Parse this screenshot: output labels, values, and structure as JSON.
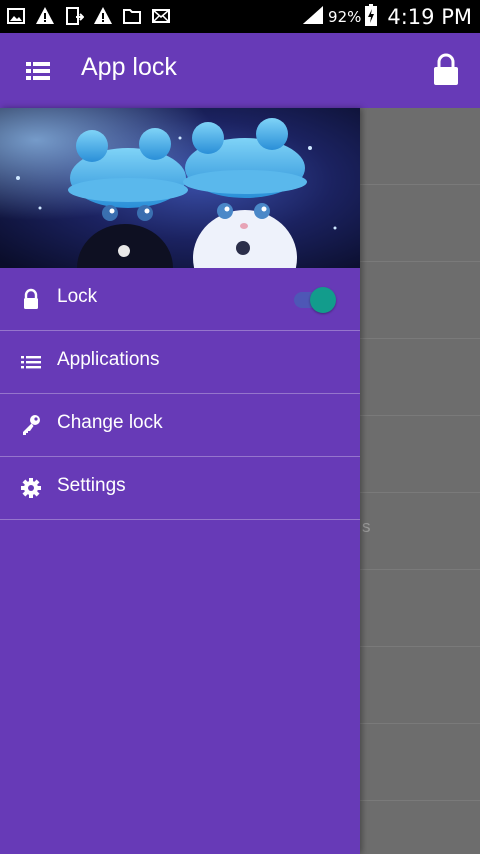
{
  "status_bar": {
    "notification_icons": [
      "image-icon",
      "warning-icon",
      "download-icon",
      "warning-icon",
      "folder-icon",
      "mail-icon"
    ],
    "battery_percent": "92%",
    "time": "4:19 PM"
  },
  "app_bar": {
    "title": "App lock",
    "menu_icon": "list-menu-icon",
    "action_icon": "lock-icon"
  },
  "drawer": {
    "header_image": "two-kittens-in-blue-hats",
    "items": [
      {
        "label": "Lock",
        "icon": "lock-icon",
        "toggle_on": true
      },
      {
        "label": "Applications",
        "icon": "list-icon"
      },
      {
        "label": "Change lock",
        "icon": "key-icon"
      },
      {
        "label": "Settings",
        "icon": "gear-icon"
      }
    ]
  },
  "background": {
    "visible_fragment": "s"
  },
  "colors": {
    "primary": "#673ab7",
    "toggle_thumb": "#129c8c",
    "toggle_track": "#4e57b6",
    "scrim": "#6d6d6d"
  }
}
